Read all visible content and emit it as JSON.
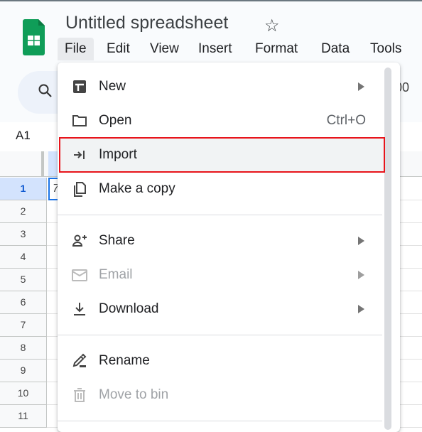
{
  "header": {
    "title": "Untitled spreadsheet",
    "menus": [
      "File",
      "Edit",
      "View",
      "Insert",
      "Format",
      "Data",
      "Tools"
    ],
    "active_menu": "File"
  },
  "formula_bar": {
    "name_box": "A1"
  },
  "grid": {
    "rows": [
      "1",
      "2",
      "3",
      "4",
      "5",
      "6",
      "7",
      "8",
      "9",
      "10",
      "11"
    ],
    "selected_row": "1",
    "a1_value": "7"
  },
  "toolbar": {
    "right_partial": "00"
  },
  "file_menu": {
    "items": [
      {
        "label": "New",
        "icon": "new-sheet-icon",
        "submenu": true
      },
      {
        "label": "Open",
        "icon": "folder-icon",
        "shortcut": "Ctrl+O"
      },
      {
        "label": "Import",
        "icon": "import-icon",
        "highlighted": true
      },
      {
        "label": "Make a copy",
        "icon": "copy-icon"
      },
      {
        "label": "Share",
        "icon": "person-add-icon",
        "submenu": true
      },
      {
        "label": "Email",
        "icon": "email-icon",
        "submenu": true,
        "disabled": true
      },
      {
        "label": "Download",
        "icon": "download-icon",
        "submenu": true
      },
      {
        "label": "Rename",
        "icon": "rename-icon"
      },
      {
        "label": "Move to bin",
        "icon": "trash-icon",
        "disabled": true
      }
    ]
  },
  "colors": {
    "brand": "#0f9d58",
    "selection": "#1a73e8",
    "highlight_border": "#e8141b"
  }
}
